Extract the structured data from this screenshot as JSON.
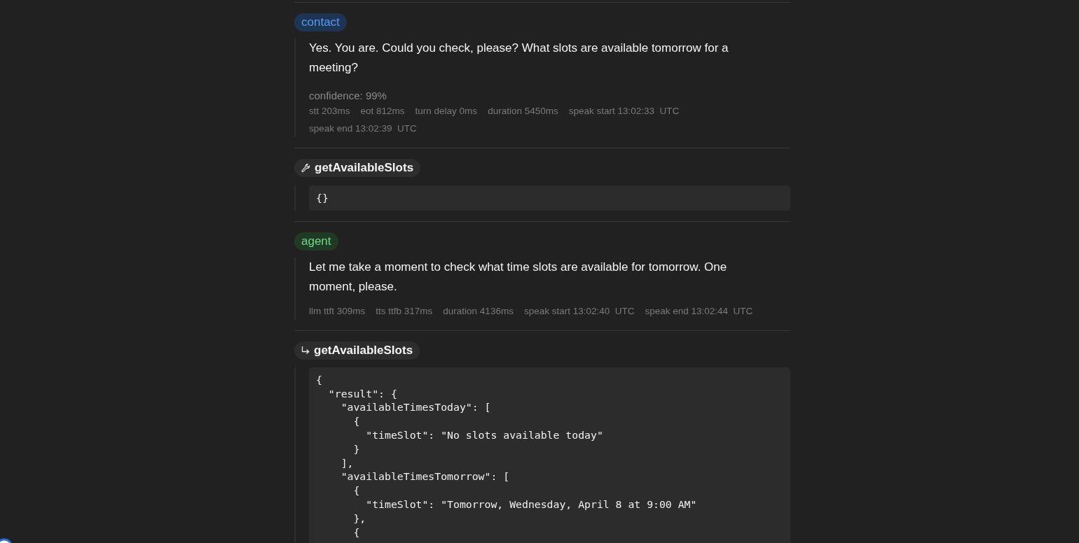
{
  "entries": [
    {
      "kind": "message",
      "role": "contact",
      "color": "#1d3553",
      "text": "Yes. You are. Could you check, please? What slots are available tomorrow for a meeting?",
      "confidence": "confidence: 99%",
      "metrics": [
        "stt 203ms",
        "eot 812ms",
        "turn delay 0ms",
        "duration 5450ms",
        "speak start 13:02:33  UTC",
        "speak end 13:02:39  UTC"
      ]
    },
    {
      "kind": "tool_call",
      "name": "getAvailableSlots",
      "code": "{}"
    },
    {
      "kind": "message",
      "role": "agent",
      "color": "#1f3b26",
      "text": "Let me take a moment to check what time slots are available for tomorrow. One moment, please.",
      "metrics": [
        "llm ttft 309ms",
        "tts ttfb 317ms",
        "duration 4136ms",
        "speak start 13:02:40  UTC",
        "speak end 13:02:44  UTC"
      ]
    },
    {
      "kind": "tool_result",
      "name": "getAvailableSlots",
      "code": "{\n  \"result\": {\n    \"availableTimesToday\": [\n      {\n        \"timeSlot\": \"No slots available today\"\n      }\n    ],\n    \"availableTimesTomorrow\": [\n      {\n        \"timeSlot\": \"Tomorrow, Wednesday, April 8 at 9:00 AM\"\n      },\n      {"
    }
  ]
}
